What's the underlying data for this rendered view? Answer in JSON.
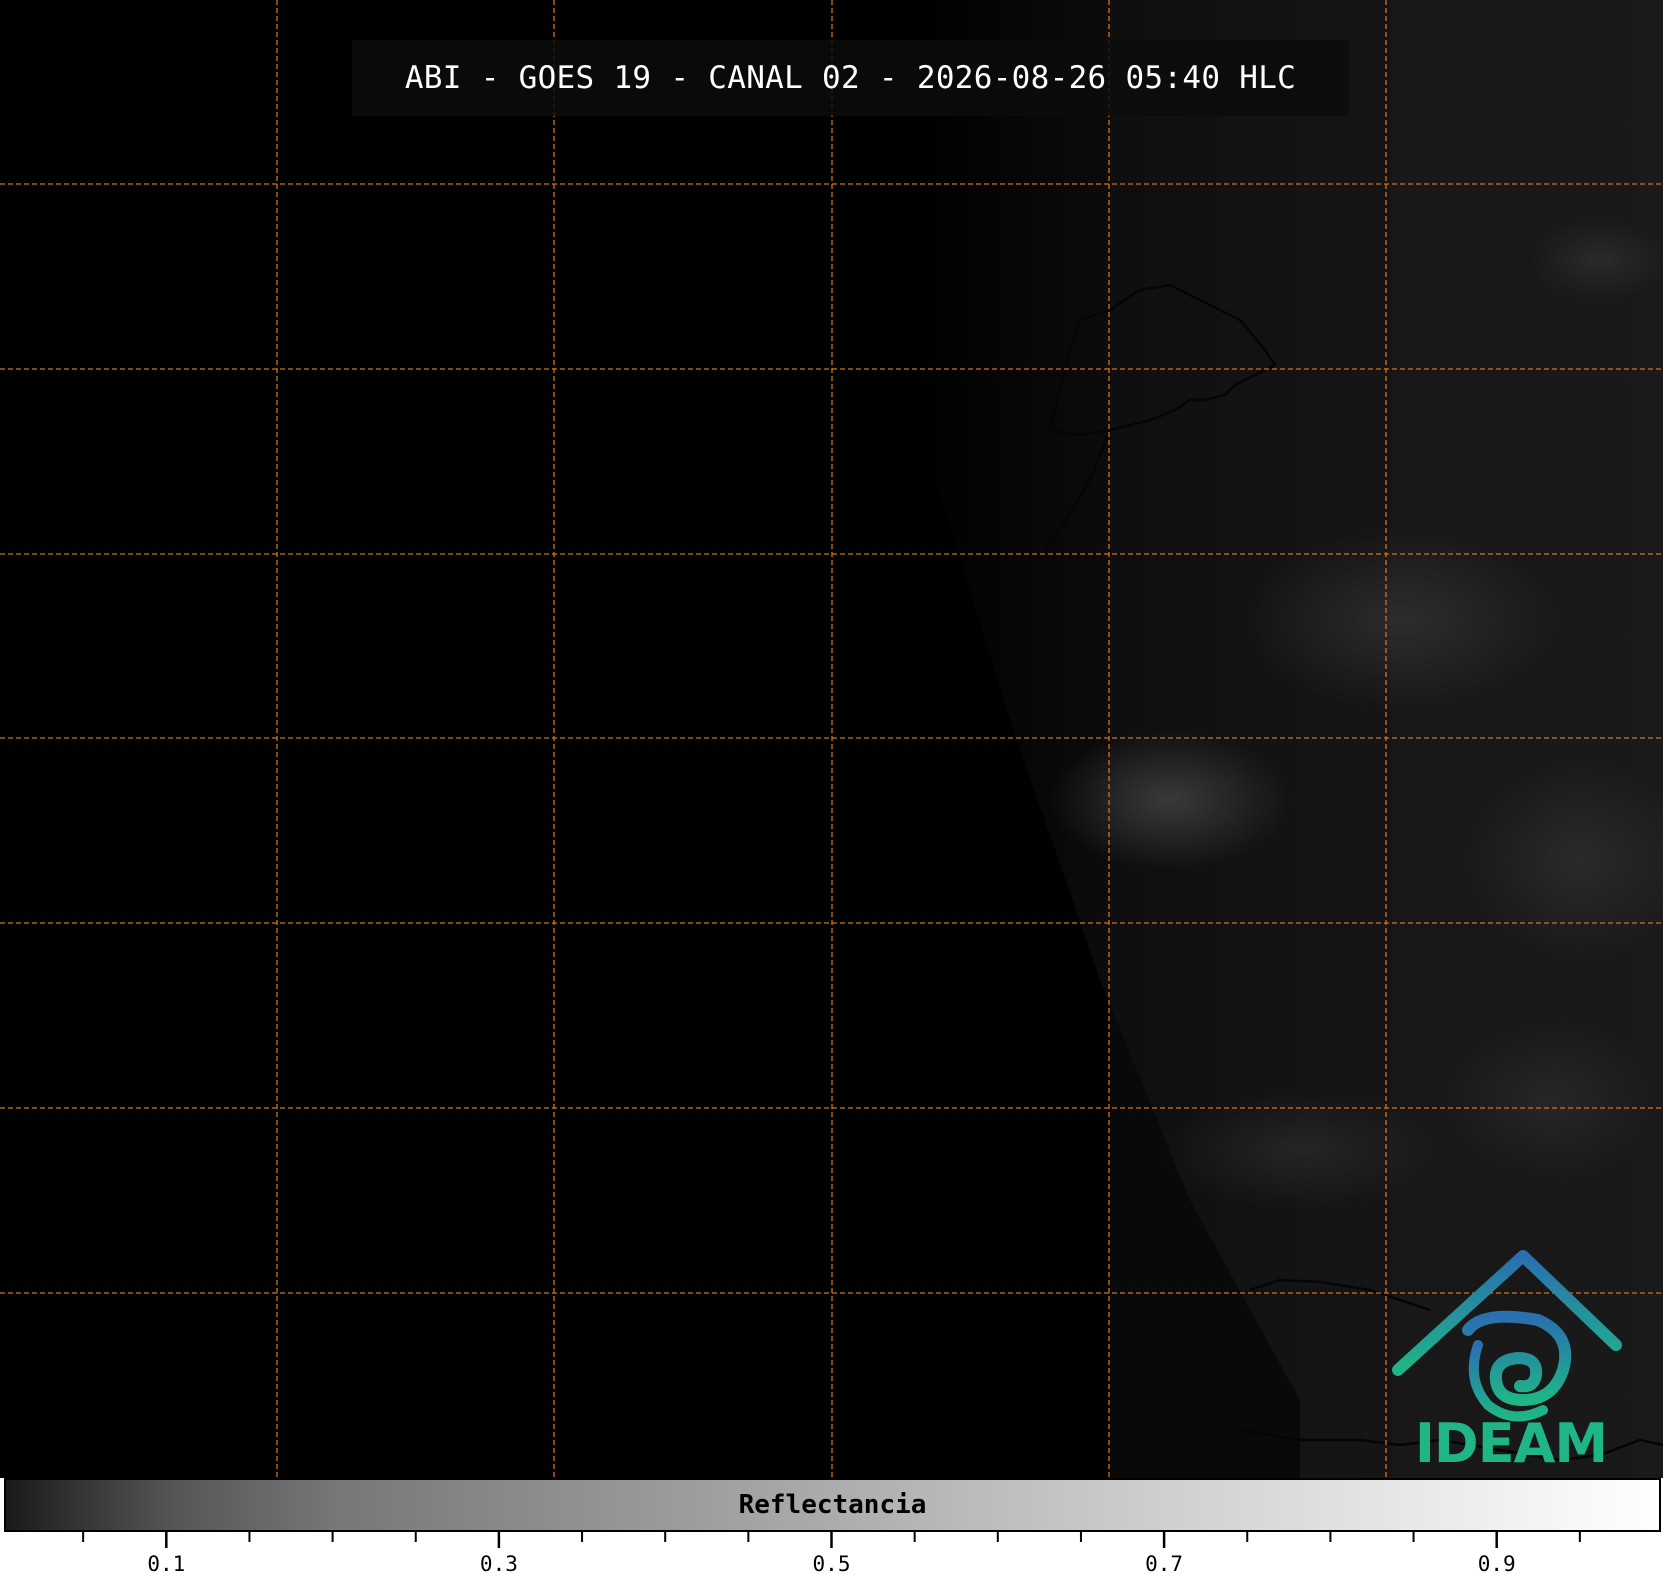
{
  "title": "ABI - GOES 19 - CANAL 02 - 2026-08-26 05:40 HLC",
  "logo_text": "IDEAM",
  "colors": {
    "grid": "#c8742a",
    "background": "#000000",
    "logo_green": "#1fb587",
    "logo_blue": "#2a6fb0"
  },
  "colorbar": {
    "label": "Reflectancia",
    "range": [
      0.0,
      1.0
    ],
    "colormap": "grayscale",
    "tick_labels": [
      "0.1",
      "0.3",
      "0.5",
      "0.7",
      "0.9"
    ],
    "tick_values": [
      0.1,
      0.3,
      0.5,
      0.7,
      0.9
    ],
    "minor_step": 0.05
  },
  "icons": [
    "ideam-logo-icon"
  ]
}
